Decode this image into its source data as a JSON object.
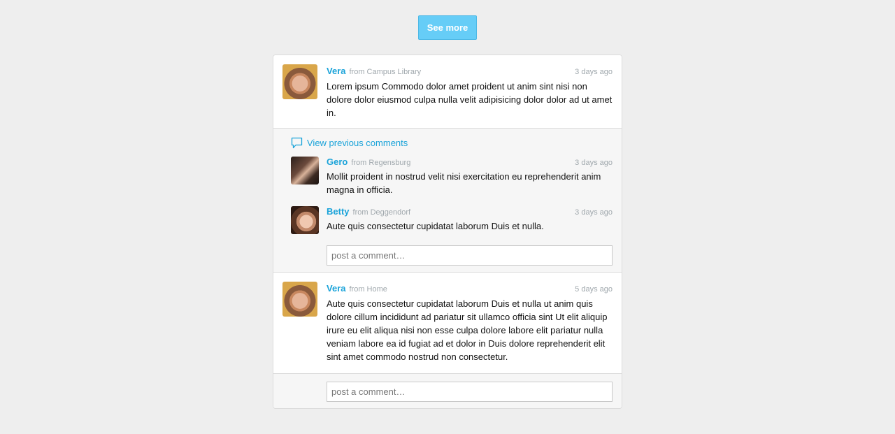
{
  "see_more_label": "See more",
  "posts": [
    {
      "author": "Vera",
      "from": "from Campus Library",
      "time": "3 days ago",
      "text": "Lorem ipsum Commodo dolor amet proident ut anim sint nisi non dolore dolor eiusmod culpa nulla velit adipisicing dolor dolor ad ut amet in.",
      "view_previous_label": "View previous comments",
      "comments": [
        {
          "author": "Gero",
          "from": "from Regensburg",
          "time": "3 days ago",
          "text": "Mollit proident in nostrud velit nisi exercitation eu reprehenderit anim magna in officia."
        },
        {
          "author": "Betty",
          "from": "from Deggendorf",
          "time": "3 days ago",
          "text": "Aute quis consectetur cupidatat laborum Duis et nulla."
        }
      ],
      "comment_placeholder": "post a comment…"
    },
    {
      "author": "Vera",
      "from": "from Home",
      "time": "5 days ago",
      "text": "Aute quis consectetur cupidatat laborum Duis et nulla ut anim quis dolore cillum incididunt ad pariatur sit ullamco officia sint Ut elit aliquip irure eu elit aliqua nisi non esse culpa dolore labore elit pariatur nulla veniam labore ea id fugiat ad et dolor in Duis dolore reprehenderit elit sint amet commodo nostrud non consectetur.",
      "comment_placeholder": "post a comment…"
    }
  ],
  "colors": {
    "accent": "#1aa3d9",
    "button": "#66cdf7",
    "meta": "#a0a8ad",
    "background": "#eeeeee"
  }
}
